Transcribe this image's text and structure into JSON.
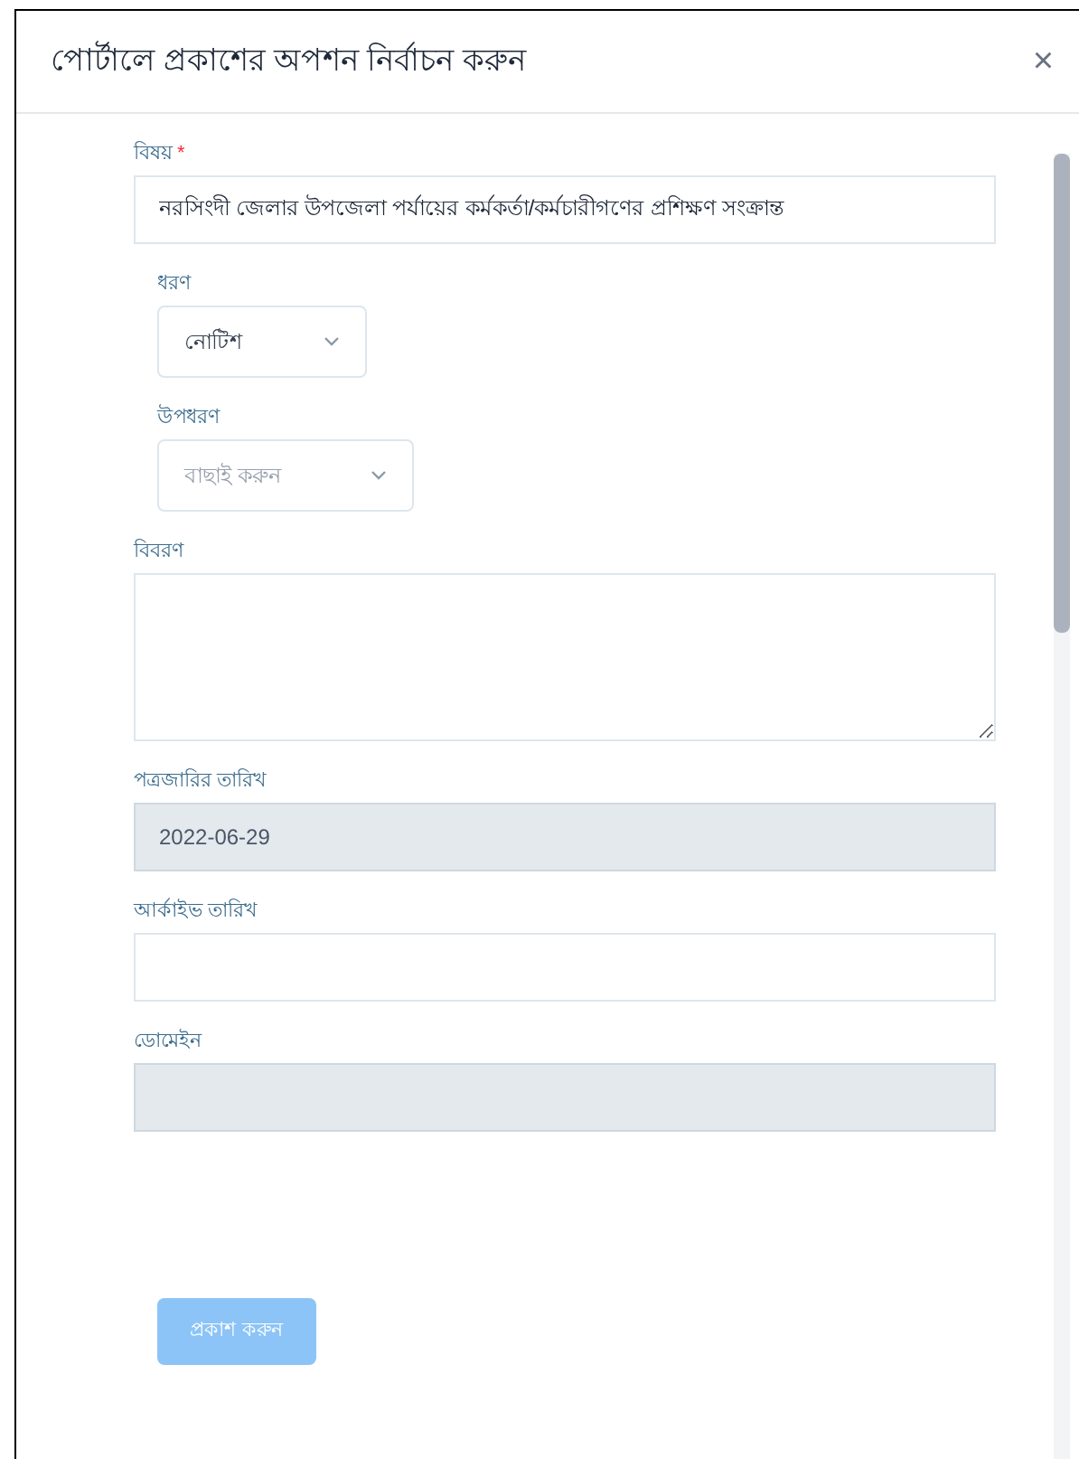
{
  "dialog": {
    "title": "পোর্টালে প্রকাশের অপশন নির্বাচন করুন",
    "close": "×"
  },
  "fields": [
    {
      "kind": "input",
      "label": "বিষয়",
      "required_mark": "*",
      "value": "নরসিংদী জেলার উপজেলা পর্যায়ের কর্মকর্তা/কর্মচারীগণের প্রশিক্ষণ সংক্রান্ত",
      "disabled": false
    },
    {
      "kind": "select",
      "label": "ধরণ",
      "value": "নোটিশ",
      "disabled": false
    },
    {
      "kind": "select",
      "label": "উপধরণ",
      "placeholder": "বাছাই করুন",
      "disabled": false
    },
    {
      "kind": "textarea",
      "label": "বিবরণ",
      "disabled": false
    },
    {
      "kind": "input",
      "label": "পত্রজারির তারিখ",
      "value": "2022-06-29",
      "disabled": true
    },
    {
      "kind": "input",
      "label": "আর্কাইভ তারিখ",
      "disabled": false
    },
    {
      "kind": "input",
      "label": "ডোমেইন",
      "disabled": true
    }
  ],
  "submit": {
    "label": "প্রকাশ করুন",
    "disabled": true
  }
}
